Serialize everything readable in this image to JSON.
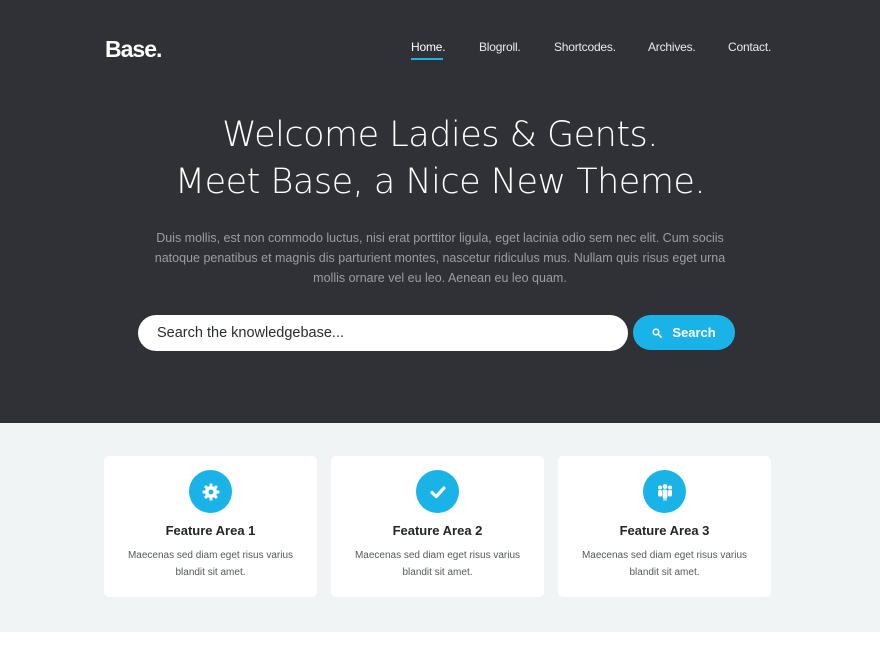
{
  "brand": {
    "logo": "Base."
  },
  "nav": {
    "items": [
      {
        "label": "Home.",
        "active": true
      },
      {
        "label": "Blogroll."
      },
      {
        "label": "Shortcodes."
      },
      {
        "label": "Archives."
      },
      {
        "label": "Contact."
      }
    ]
  },
  "hero": {
    "title_line1": "Welcome Ladies & Gents.",
    "title_line2": "Meet Base, a Nice New Theme.",
    "text_line1": "Duis mollis, est non commodo luctus, nisi erat porttitor ligula, eget lacinia odio sem nec elit. Cum sociis",
    "text_line2": "natoque penatibus et magnis dis parturient montes, nascetur ridiculus mus. Nullam quis risus eget urna",
    "text_line3": "mollis ornare vel eu leo. Aenean eu leo quam."
  },
  "search": {
    "placeholder": "Search the knowledgebase...",
    "button_label": "Search",
    "button_icon": "search-icon"
  },
  "features": [
    {
      "icon": "gear-icon",
      "title": "Feature Area 1",
      "text_line1": "Maecenas sed diam eget risus varius",
      "text_line2": "blandit sit amet."
    },
    {
      "icon": "checkmark-icon",
      "title": "Feature Area 2",
      "text_line1": "Maecenas sed diam eget risus varius",
      "text_line2": "blandit sit amet."
    },
    {
      "icon": "users-icon",
      "title": "Feature Area 3",
      "text_line1": "Maecenas sed diam eget risus varius",
      "text_line2": "blandit sit amet."
    }
  ],
  "colors": {
    "hero_bg": "#2f3136",
    "accent": "#1ab3e8",
    "features_bg": "#f1f4f5",
    "card_bg": "#ffffff"
  }
}
